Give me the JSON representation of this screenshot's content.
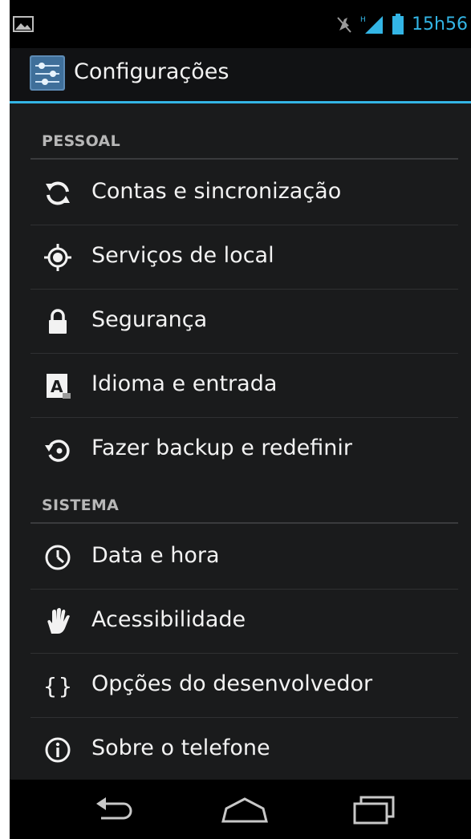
{
  "status_bar": {
    "time": "15h56",
    "icons": [
      "image-notification-icon",
      "mute-icon",
      "signal-icon",
      "battery-icon"
    ]
  },
  "action_bar": {
    "title": "Configurações",
    "app_icon": "settings-app-icon"
  },
  "sections": [
    {
      "header": "PESSOAL",
      "items": [
        {
          "label": "Contas e sincronização",
          "icon": "sync-icon"
        },
        {
          "label": "Serviços de local",
          "icon": "location-icon"
        },
        {
          "label": "Segurança",
          "icon": "lock-icon"
        },
        {
          "label": "Idioma e entrada",
          "icon": "language-icon"
        },
        {
          "label": "Fazer backup e redefinir",
          "icon": "backup-icon"
        }
      ]
    },
    {
      "header": "SISTEMA",
      "items": [
        {
          "label": "Data e hora",
          "icon": "clock-icon"
        },
        {
          "label": "Acessibilidade",
          "icon": "hand-icon"
        },
        {
          "label": "Opções do desenvolvedor",
          "icon": "braces-icon"
        },
        {
          "label": "Sobre o telefone",
          "icon": "info-icon"
        }
      ]
    }
  ],
  "nav_bar": [
    "back-icon",
    "home-icon",
    "recent-apps-icon"
  ],
  "colors": {
    "accent": "#33b5e5",
    "background": "#1a1b1c",
    "text": "#f2f2f2",
    "section_header": "#b7b7b7"
  }
}
